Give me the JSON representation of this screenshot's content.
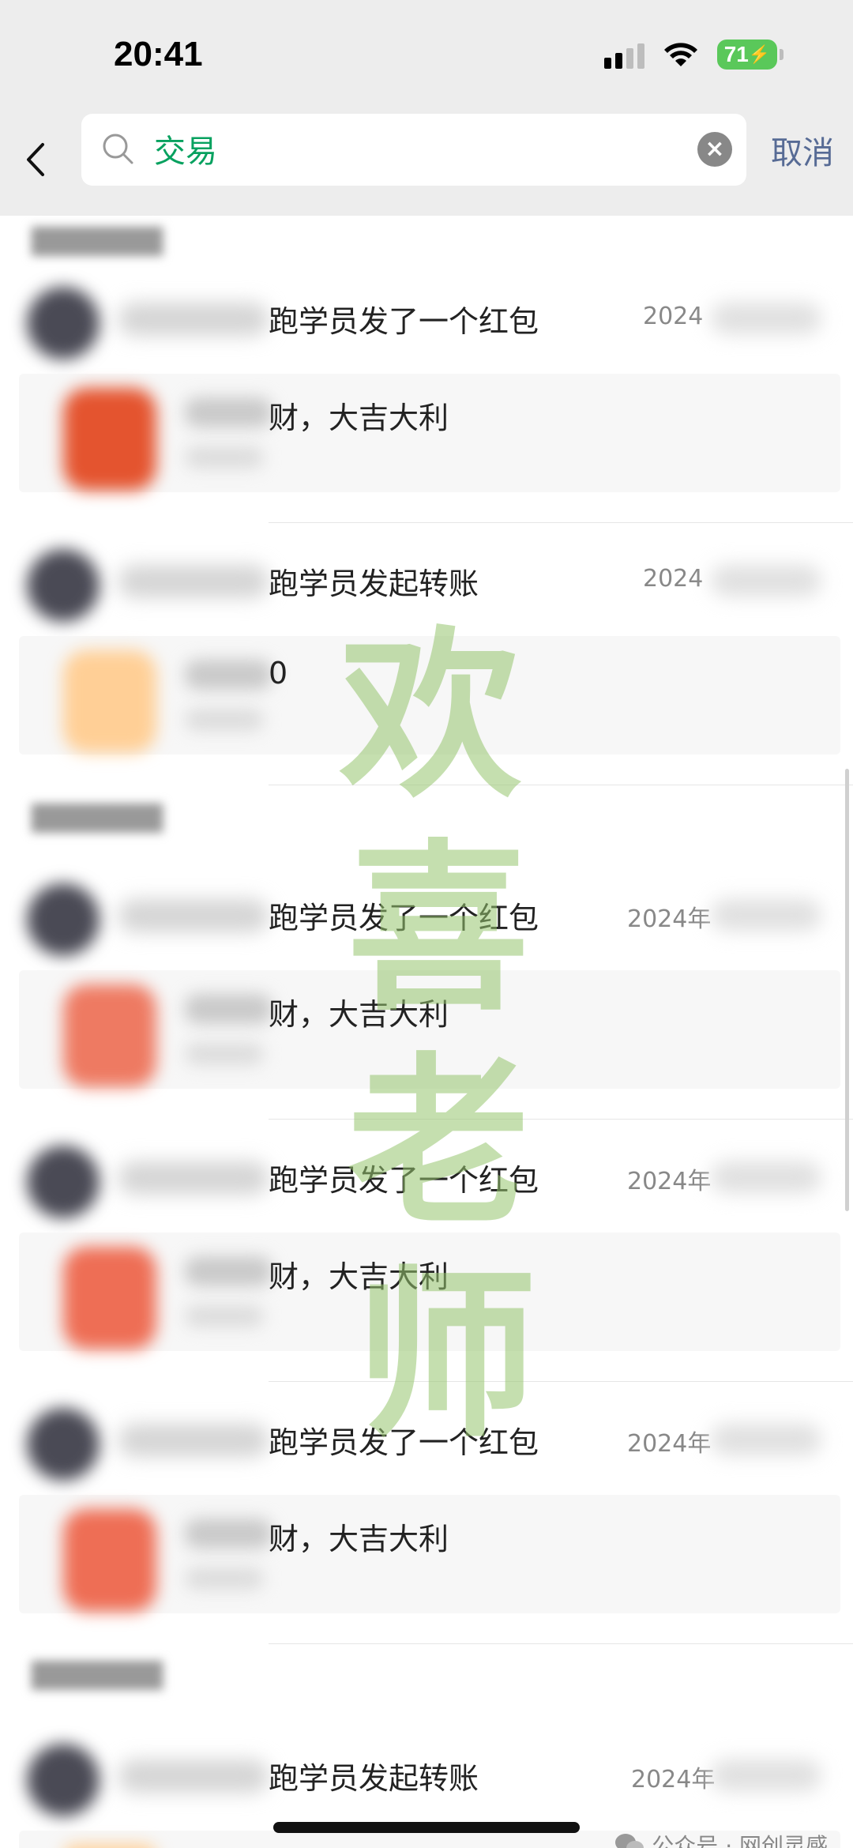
{
  "status_bar": {
    "time": "20:41",
    "battery": "71"
  },
  "search": {
    "query": "交易",
    "cancel_label": "取消"
  },
  "cards": [
    {
      "title": "跑学员发了一个红包",
      "date": "2024",
      "detail": "财，大吉大利",
      "kind": "red"
    },
    {
      "title": "跑学员发起转账",
      "date": "2024",
      "detail": "0",
      "kind": "orange"
    },
    {
      "title": "跑学员发了一个红包",
      "date": "2024年",
      "detail": "财，大吉大利",
      "kind": "red"
    },
    {
      "title": "跑学员发了一个红包",
      "date": "2024年",
      "detail": "财，大吉大利",
      "kind": "red"
    },
    {
      "title": "跑学员发了一个红包",
      "date": "2024年",
      "detail": "财，大吉大利",
      "kind": "red"
    },
    {
      "title": "跑学员发起转账",
      "date": "2024年",
      "detail": "",
      "kind": "orange"
    }
  ],
  "watermark": [
    "欢",
    "喜",
    "老",
    "师"
  ],
  "footer": {
    "credit": "公众号 · 网创灵感"
  },
  "colors": {
    "search_text": "#07a15f",
    "cancel": "#576b95",
    "battery": "#5ac85a"
  }
}
